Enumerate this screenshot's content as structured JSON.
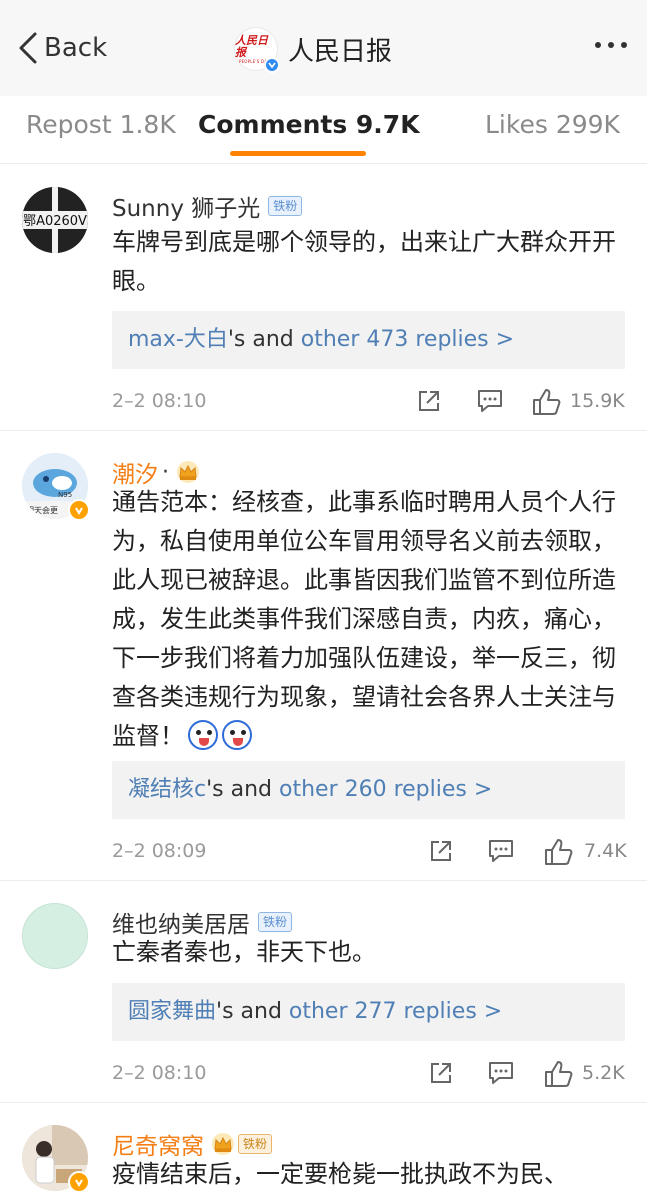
{
  "header": {
    "back_label": "Back",
    "title": "人民日报",
    "logo_text": "人民日报",
    "logo_sub": "PEOPLE'S DAILY"
  },
  "tabs": [
    {
      "label": "Repost 1.8K",
      "active": false
    },
    {
      "label": "Comments 9.7K",
      "active": true
    },
    {
      "label": "Likes 299K",
      "active": false
    }
  ],
  "colors": {
    "accent": "#ff8200",
    "link_blue": "#4f7fb4",
    "verified_blue": "#2f8cf0",
    "verified_orange": "#ffa200"
  },
  "comments": [
    {
      "user": "Sunny 狮子光",
      "badge": "铁粉",
      "avatar_text": "鄂A0260V",
      "text": "车牌号到底是哪个领导的，出来让广大群众开开眼。",
      "replies": {
        "first": "max-大白",
        "mid": "'s and ",
        "rest": "other 473 replies >"
      },
      "time": "2–2 08:10",
      "likes": "15.9K"
    },
    {
      "user": "潮汐",
      "user_suffix": "·",
      "avatar_text": "明天会更",
      "text": "通告范本：经核查，此事系临时聘用人员个人行为，私自使用单位公车冒用领导名义前去领取，此人现已被辞退。此事皆因我们监管不到位所造成，发生此类事件我们深感自责，内疚，痛心，下一步我们将着力加强队伍建设，举一反三，彻查各类违规行为现象，望请社会各界人士关注与监督！",
      "replies": {
        "first": "凝结核c",
        "mid": "'s and ",
        "rest": "other 260 replies >"
      },
      "time": "2–2 08:09",
      "likes": "7.4K"
    },
    {
      "user": "维也纳美居居",
      "badge": "铁粉",
      "text": "亡秦者秦也，非天下也。",
      "replies": {
        "first": "圆家舞曲",
        "mid": "'s and ",
        "rest": "other 277 replies >"
      },
      "time": "2–2 08:10",
      "likes": "5.2K"
    },
    {
      "user": "尼奇窝窝",
      "badge": "铁粉",
      "text": "疫情结束后，一定要枪毙一批执政不为民、"
    }
  ]
}
